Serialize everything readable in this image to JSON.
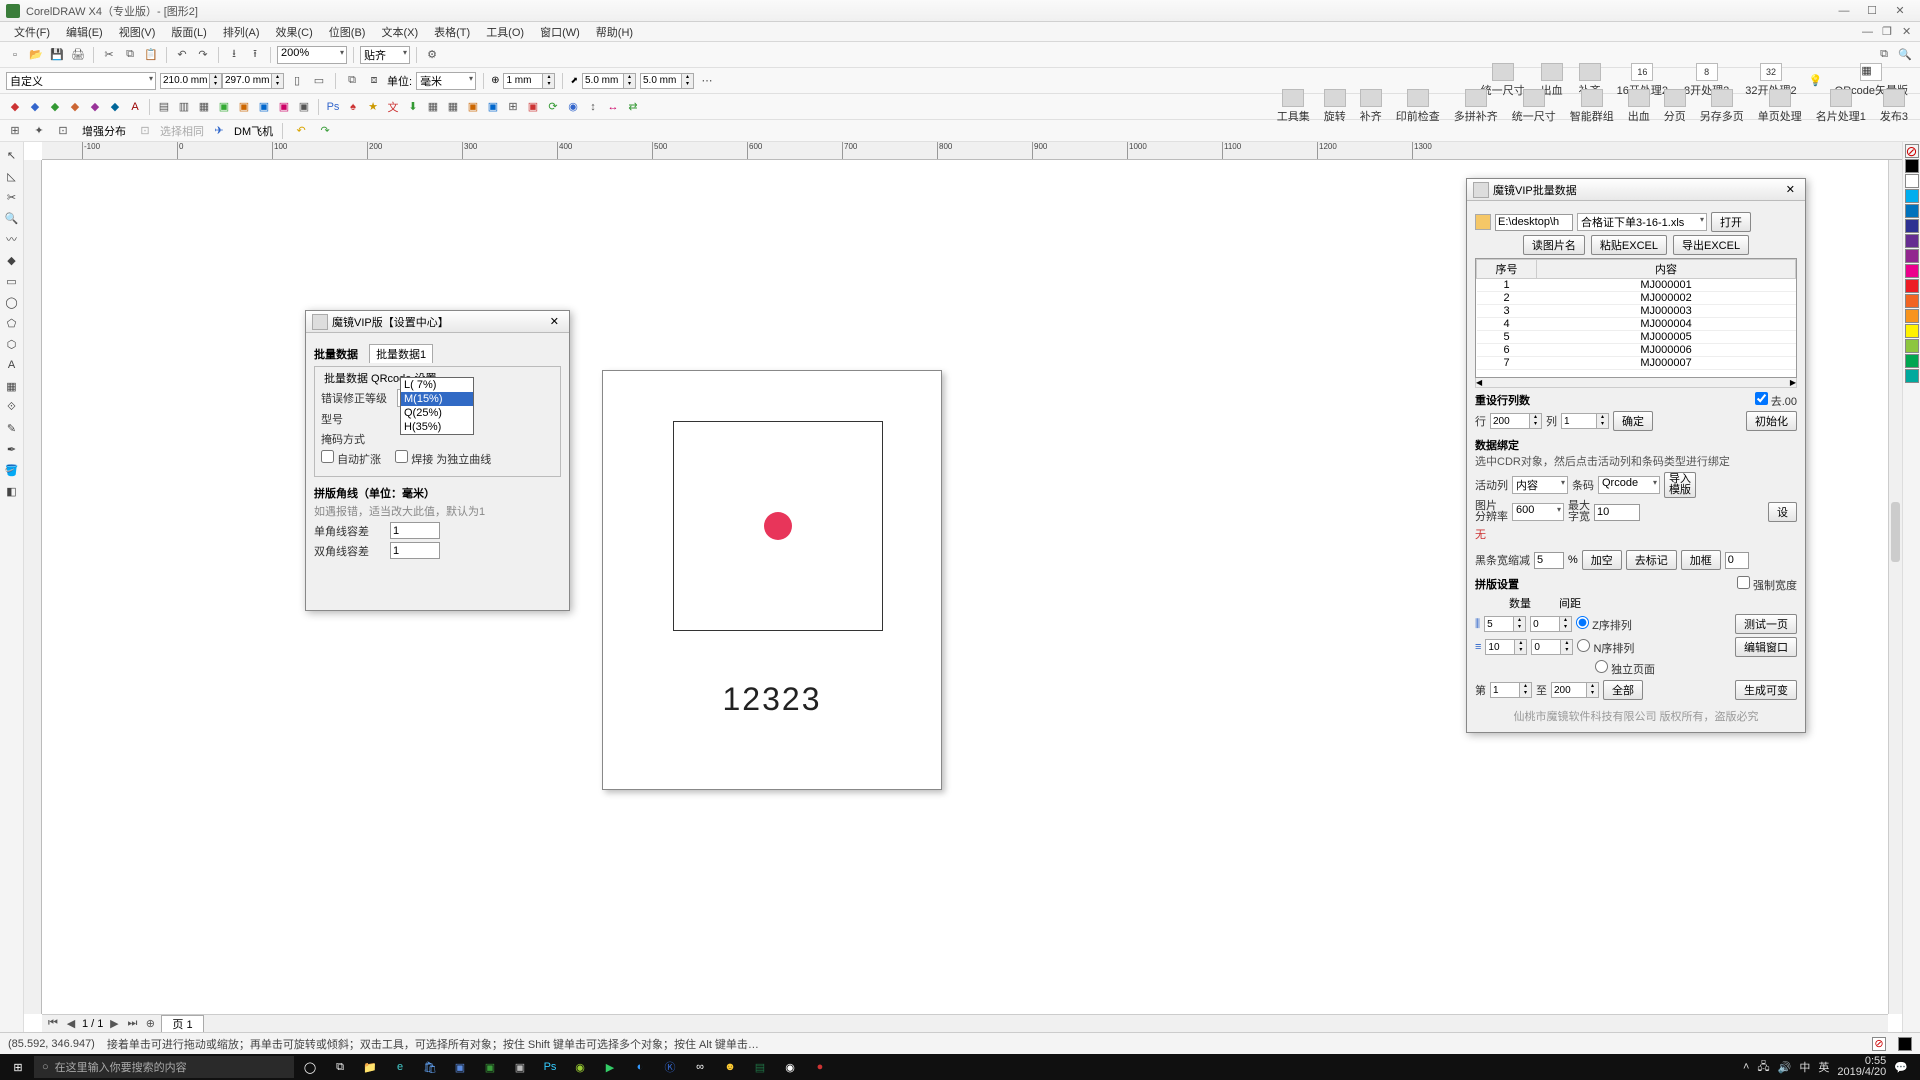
{
  "app": {
    "title": "CorelDRAW X4（专业版）- [图形2]"
  },
  "menu": [
    "文件(F)",
    "编辑(E)",
    "视图(V)",
    "版面(L)",
    "排列(A)",
    "效果(C)",
    "位图(B)",
    "文本(X)",
    "表格(T)",
    "工具(O)",
    "窗口(W)",
    "帮助(H)"
  ],
  "zoom": "200%",
  "paste_label": "贴齐",
  "doc": {
    "w": "210.0 mm",
    "h": "297.0 mm",
    "unit_label": "单位:",
    "unit": "毫米",
    "nudge": "1 mm",
    "dup_x": "5.0 mm",
    "dup_y": "5.0 mm"
  },
  "preset": "自定义",
  "bigbtns1": [
    "统一尺寸",
    "出血",
    "补齐"
  ],
  "bigbtns_nums": [
    {
      "num": "16",
      "label": "16开处理2"
    },
    {
      "num": "8",
      "label": "8开处理2"
    },
    {
      "num": "32",
      "label": "32开处理2"
    }
  ],
  "qrcode_label": "QRcode矢量版",
  "bigbtns2": [
    "工具集",
    "旋转",
    "补齐",
    "印前检查",
    "多拼补齐",
    "统一尺寸",
    "智能群组",
    "出血",
    "分页",
    "另存多页",
    "单页处理",
    "名片处理1",
    "发布3"
  ],
  "row5": {
    "enhance": "增强分布",
    "selsim": "选择相同",
    "dm": "DM飞机"
  },
  "canvas_text": "12323",
  "ruler_marks": [
    -100,
    0,
    100,
    200,
    300,
    400,
    500,
    600,
    700,
    800,
    900,
    1000,
    1100,
    1200,
    1300
  ],
  "pagebar": {
    "pos": "1 / 1",
    "tab": "页 1"
  },
  "status": {
    "coord": "(85.592, 346.947)",
    "hint": "接着单击可进行拖动或缩放；再单击可旋转或倾斜；双击工具，可选择所有对象；按住 Shift 键单击可选择多个对象；按住 Alt 键单击…"
  },
  "dlg_settings": {
    "title": "魔镜VIP版【设置中心】",
    "tab_group": "批量数据",
    "tab": "批量数据1",
    "section": "批量数据 QRcode 设置",
    "err_label": "错误修正等级",
    "err_value": "M(15%)",
    "err_options": [
      "L( 7%)",
      "M(15%)",
      "Q(25%)",
      "H(35%)"
    ],
    "err_selected": "M(15%)",
    "type_label": "型号",
    "encode_label": "掩码方式",
    "auto_expand": "自动扩涨",
    "weld_curve": "焊接 为独立曲线",
    "diag_title": "拼版角线（单位：毫米）",
    "diag_hint": "如遇报错，适当改大此值，默认为1",
    "single_tol": "单角线容差",
    "single_val": "1",
    "double_tol": "双角线容差",
    "double_val": "1"
  },
  "dlg_batch": {
    "title": "魔镜VIP批量数据",
    "path": "E:\\desktop\\h",
    "file": "合格证下单3-16-1.xls",
    "open": "打开",
    "read_names": "读图片名",
    "paste_xl": "粘贴EXCEL",
    "export_xl": "导出EXCEL",
    "col_seq": "序号",
    "col_content": "内容",
    "rows": [
      [
        "1",
        "MJ000001"
      ],
      [
        "2",
        "MJ000002"
      ],
      [
        "3",
        "MJ000003"
      ],
      [
        "4",
        "MJ000004"
      ],
      [
        "5",
        "MJ000005"
      ],
      [
        "6",
        "MJ000006"
      ],
      [
        "7",
        "MJ000007"
      ]
    ],
    "reset_cols": "重设行列数",
    "row_label": "行",
    "row_val": "200",
    "col_label": "列",
    "col_val": "1",
    "ok": "确定",
    "drop_zero": "去.00",
    "init": "初始化",
    "bind_title": "数据绑定",
    "bind_hint": "选中CDR对象，然后点击活动列和条码类型进行绑定",
    "active_col": "活动列",
    "active_val": "内容",
    "barcode": "条码",
    "barcode_val": "Qrcode",
    "import_tpl": "导入\n模版",
    "img_res": "图片\n分辨率",
    "img_res_val": "600",
    "max_chw": "最大\n字宽",
    "max_chw_val": "10",
    "set": "设",
    "none": "无",
    "shrink": "黑条宽缩减",
    "shrink_val": "5",
    "pct": "%",
    "addsp": "加空",
    "demark": "去标记",
    "addchk": "加框",
    "addchk_val": "0",
    "layout_title": "拼版设置",
    "qty": "数量",
    "gap": "间距",
    "qty_h": "5",
    "gap_h": "0",
    "qty_v": "10",
    "gap_v": "0",
    "z_order": "Z序排列",
    "n_order": "N序排列",
    "indep_page": "独立页面",
    "force_w": "强制宽度",
    "test_page": "测试一页",
    "edit_win": "编辑窗口",
    "nth": "第",
    "nth_val": "1",
    "to": "至",
    "to_val": "200",
    "all": "全部",
    "gen": "生成可变",
    "copyright": "仙桃市魔镜软件科技有限公司  版权所有，盗版必究"
  },
  "palette": [
    "#000",
    "#fff",
    "#00aeef",
    "#0072bc",
    "#2e3192",
    "#662d91",
    "#92278f",
    "#ec008c",
    "#ed1c24",
    "#f26522",
    "#f7941d",
    "#fff200",
    "#8dc63f",
    "#00a651",
    "#00a99d"
  ],
  "taskbar": {
    "search_ph": "在这里输入你要搜索的内容",
    "time": "0:55",
    "date": "2019/4/20",
    "ime": "英",
    "net": "中"
  }
}
